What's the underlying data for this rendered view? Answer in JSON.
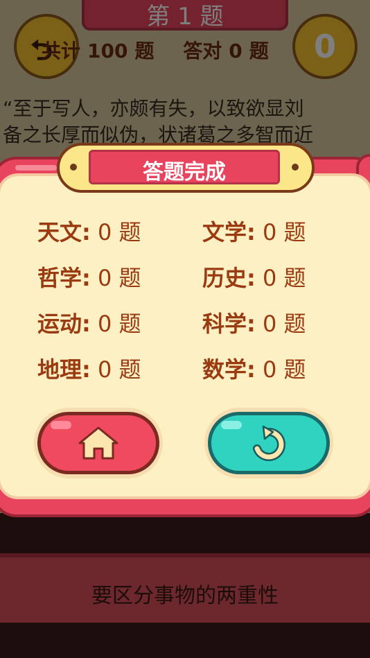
{
  "background": {
    "question_number": "第 1 题",
    "total_label": "共计",
    "total_count": "100",
    "total_unit": "题",
    "correct_label": "答对",
    "correct_count": "0",
    "correct_unit": "题",
    "score": "0",
    "question_text_line1": "“至于写人，亦颇有失，以致欲显刘",
    "question_text_line2": "备之长厚而似伪，状诸葛之多智而近",
    "answer_option": "要区分事物的两重性"
  },
  "dialog": {
    "title": "答题完成",
    "categories": [
      {
        "label": "天文:",
        "value": "0 题"
      },
      {
        "label": "文学:",
        "value": "0 题"
      },
      {
        "label": "哲学:",
        "value": "0 题"
      },
      {
        "label": "历史:",
        "value": "0 题"
      },
      {
        "label": "运动:",
        "value": "0 题"
      },
      {
        "label": "科学:",
        "value": "0 题"
      },
      {
        "label": "地理:",
        "value": "0 题"
      },
      {
        "label": "数学:",
        "value": "0 题"
      }
    ],
    "home_icon": "home-icon",
    "retry_icon": "retry-icon"
  },
  "colors": {
    "dialog_red": "#e8445d",
    "panel_cream": "#fdf0c4",
    "label_brown": "#9a3a10",
    "home_button": "#f04a5e",
    "retry_button": "#2fd3c0"
  }
}
